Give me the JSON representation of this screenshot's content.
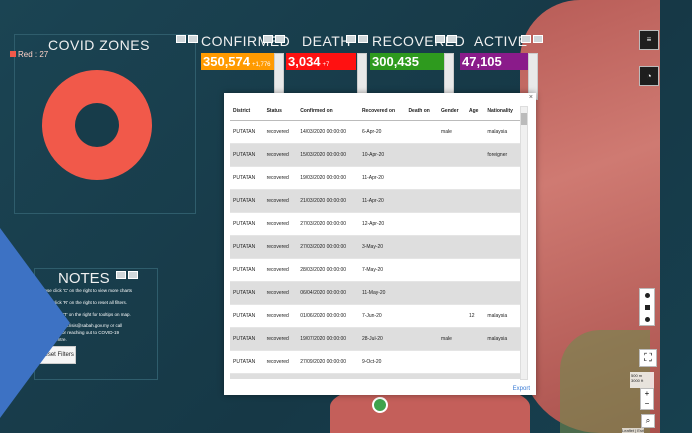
{
  "zones": {
    "title": "COVID ZONES",
    "legend": "Red : 27",
    "red_color": "#f1594a"
  },
  "stats": {
    "confirmed": {
      "title": "CONFIRMED",
      "value": "350,574",
      "delta": "+1,776",
      "color": "#ff9a00"
    },
    "death": {
      "title": "DEATH",
      "value": "3,034",
      "delta": "+7",
      "color": "#ff1111"
    },
    "recovered": {
      "title": "RECOVERED",
      "value": "300,435",
      "delta": "",
      "color": "#2e9a1e"
    },
    "active": {
      "title": "ACTIVE",
      "value": "47,105",
      "delta": "",
      "color": "#8a1b8a"
    }
  },
  "notes": {
    "title": "NOTES",
    "lines": [
      "Please click 'C' on the right to view more charts",
      "Please click 'R' on the right to reset all filters.",
      "Click 'T' on the right for tooltips on map.",
      "mail to crisis@sabah.gov.my or call",
      "435 for reaching out to COVID-19",
      "Centre."
    ],
    "reset_label": "Reset Filters"
  },
  "table": {
    "columns": [
      "District",
      "Status",
      "Confirmed on",
      "Recovered on",
      "Death on",
      "Gender",
      "Age",
      "Nationality"
    ],
    "rows": [
      [
        "PUTATAN",
        "recovered",
        "14/03/2020 00:00:00",
        "6-Apr-20",
        "",
        "male",
        "",
        "malaysia"
      ],
      [
        "PUTATAN",
        "recovered",
        "15/03/2020 00:00:00",
        "10-Apr-20",
        "",
        "",
        "",
        "foreigner"
      ],
      [
        "PUTATAN",
        "recovered",
        "19/03/2020 00:00:00",
        "11-Apr-20",
        "",
        "",
        "",
        ""
      ],
      [
        "PUTATAN",
        "recovered",
        "21/03/2020 00:00:00",
        "11-Apr-20",
        "",
        "",
        "",
        ""
      ],
      [
        "PUTATAN",
        "recovered",
        "27/03/2020 00:00:00",
        "12-Apr-20",
        "",
        "",
        "",
        ""
      ],
      [
        "PUTATAN",
        "recovered",
        "27/03/2020 00:00:00",
        "3-May-20",
        "",
        "",
        "",
        ""
      ],
      [
        "PUTATAN",
        "recovered",
        "28/03/2020 00:00:00",
        "7-May-20",
        "",
        "",
        "",
        ""
      ],
      [
        "PUTATAN",
        "recovered",
        "06/04/2020 00:00:00",
        "11-May-20",
        "",
        "",
        "",
        ""
      ],
      [
        "PUTATAN",
        "recovered",
        "01/06/2020 00:00:00",
        "7-Jun-20",
        "",
        "",
        "12",
        "malaysia"
      ],
      [
        "PUTATAN",
        "recovered",
        "19/07/2020 00:00:00",
        "28-Jul-20",
        "",
        "male",
        "",
        "malaysia"
      ],
      [
        "PUTATAN",
        "recovered",
        "27/09/2020 00:00:00",
        "9-Oct-20",
        "",
        "",
        "",
        ""
      ],
      [
        "PUTATAN",
        "recovered",
        "28/09/2020 00:00:00",
        "10-Oct-20",
        "",
        "",
        "",
        ""
      ]
    ],
    "export_label": "Export",
    "close_label": "×"
  },
  "map": {
    "scale_top": "500 m",
    "scale_bottom": "3000 ft",
    "attribution": "Leaflet | Esri"
  },
  "icons": {
    "menu": "menu-icon",
    "pie": "pie-chart-icon",
    "fullscreen": "fullscreen-icon",
    "search": "search-icon"
  }
}
